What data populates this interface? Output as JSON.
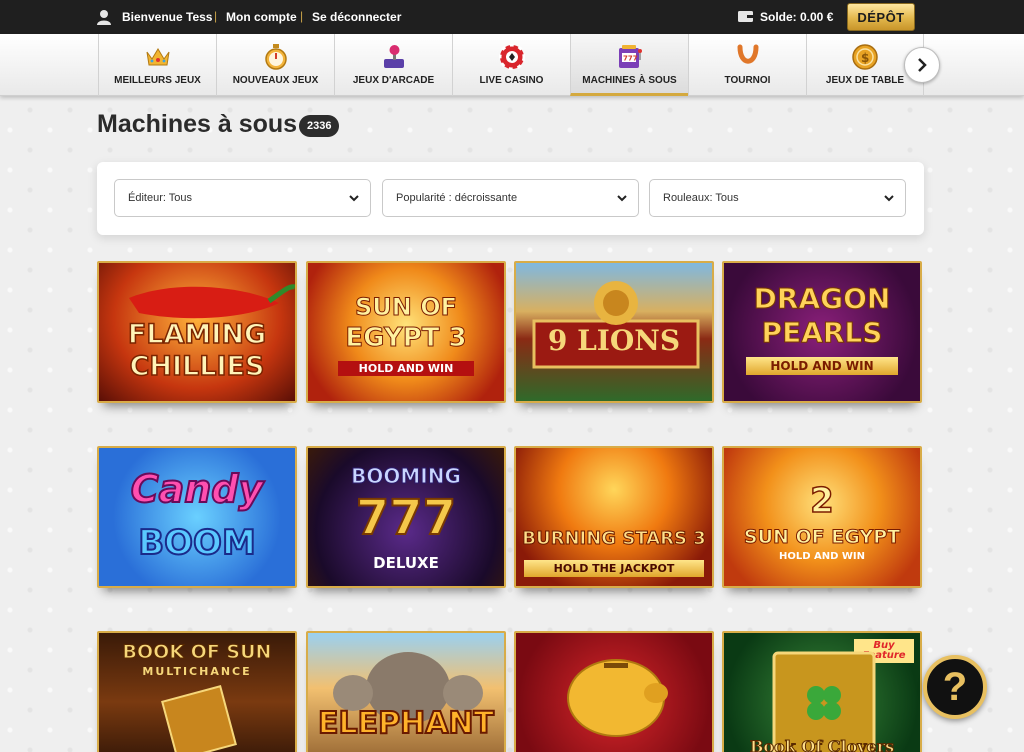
{
  "topbar": {
    "greeting": "Bienvenue Tess",
    "account_link": "Mon compte",
    "logout_link": "Se déconnecter",
    "balance": "Solde: 0.00 €",
    "deposit_button": "DÉPÔT"
  },
  "categories": [
    {
      "label": "MEILLEURS JEUX",
      "icon": "crown-icon"
    },
    {
      "label": "NOUVEAUX JEUX",
      "icon": "stopwatch-icon"
    },
    {
      "label": "JEUX D'ARCADE",
      "icon": "joystick-icon"
    },
    {
      "label": "LIVE CASINO",
      "icon": "poker-chip-icon"
    },
    {
      "label": "MACHINES À SOUS",
      "icon": "slot-machine-icon",
      "active": true
    },
    {
      "label": "TOURNOI",
      "icon": "horseshoe-icon"
    },
    {
      "label": "JEUX DE TABLE",
      "icon": "coin-icon"
    }
  ],
  "page": {
    "title": "Machines à sous",
    "count": "2336"
  },
  "filters": {
    "publisher": "Éditeur: Tous",
    "popularity": "Popularité : décroissante",
    "reels": "Rouleaux: Tous"
  },
  "games": [
    {
      "line1": "FLAMING",
      "line2": "CHILLIES",
      "line3": ""
    },
    {
      "line1": "SUN OF",
      "line2": "EGYPT 3",
      "line3": "HOLD AND WIN"
    },
    {
      "line1": "9 LIONS",
      "line2": "",
      "line3": ""
    },
    {
      "line1": "DRAGON",
      "line2": "PEARLS",
      "line3": "HOLD AND WIN"
    },
    {
      "line1": "Candy",
      "line2": "BOOM",
      "line3": ""
    },
    {
      "line1": "BOOMING",
      "line2": "777",
      "line3": "DELUXE"
    },
    {
      "line1": "BURNING STARS 3",
      "line2": "HOLD THE JACKPOT",
      "line3": ""
    },
    {
      "line1": "2",
      "line2": "SUN OF EGYPT",
      "line3": "HOLD AND WIN"
    },
    {
      "line1": "BOOK OF SUN",
      "line2": "MULTICHANCE",
      "line3": ""
    },
    {
      "line1": "ELEPHANT",
      "line2": "",
      "line3": ""
    },
    {
      "line1": "",
      "line2": "",
      "line3": ""
    },
    {
      "line1": "Buy Feature",
      "line2": "Book Of Clovers",
      "line3": ""
    }
  ],
  "help": "?",
  "colors": {
    "gold": "#d8ac48",
    "topbar": "#1f1f1f",
    "background": "#efefef"
  }
}
